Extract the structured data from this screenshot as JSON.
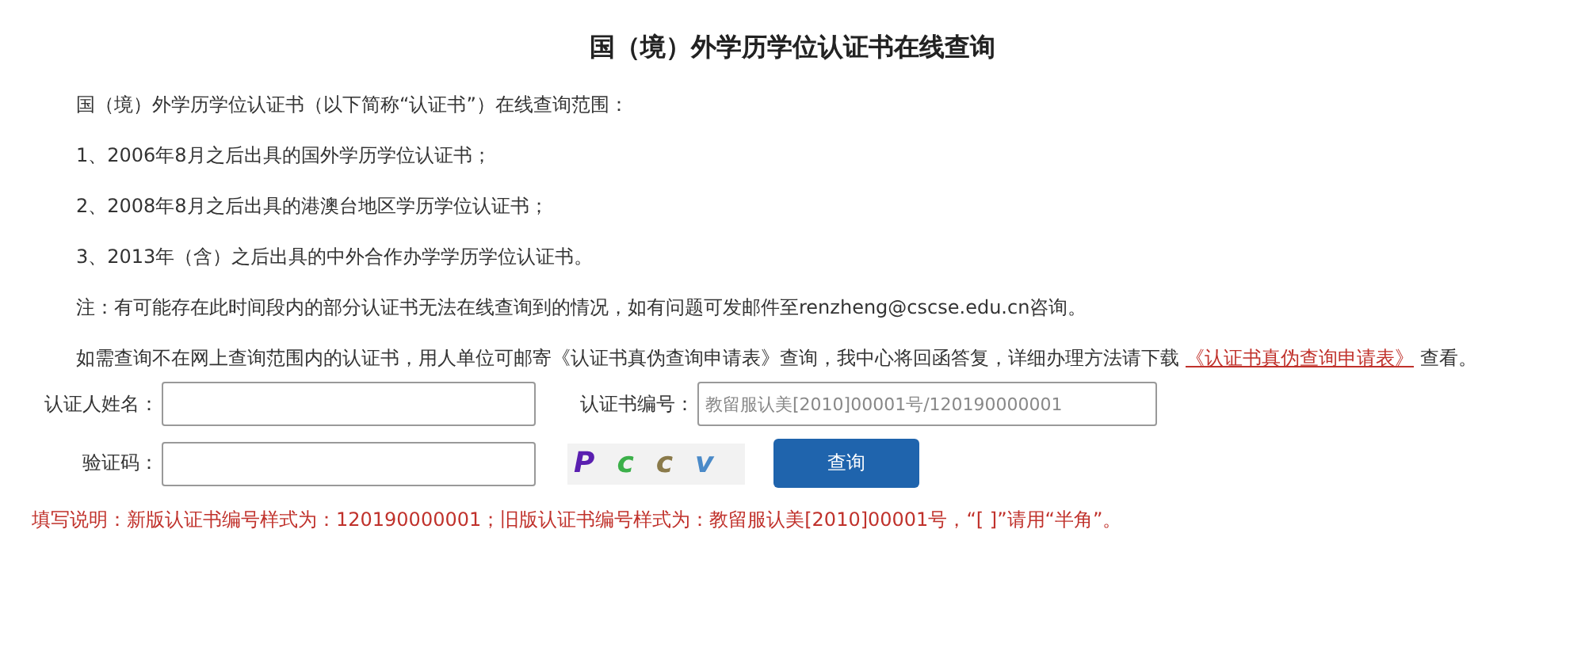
{
  "title": "国（境）外学历学位认证书在线查询",
  "paragraphs": [
    {
      "text": "国（境）外学历学位认证书（以下简称“认证书”）在线查询范围："
    },
    {
      "text": "1、2006年8月之后出具的国外学历学位认证书；"
    },
    {
      "text": "2、2008年8月之后出具的港澳台地区学历学位认证书；"
    },
    {
      "text": "3、2013年（含）之后出具的中外合作办学学历学位认证书。"
    },
    {
      "text": "注：有可能存在此时间段内的部分认证书无法在线查询到的情况，如有问题可发邮件至renzheng@cscse.edu.cn咨询。"
    }
  ],
  "download_note": {
    "before": "如需查询不在网上查询范围内的认证书，用人单位可邮寄《认证书真伪查询申请表》查询，我中心将回函答复，详细办理方法请下载",
    "link": "《认证书真伪查询申请表》",
    "after": "查看。"
  },
  "form": {
    "name_label": "认证人姓名：",
    "cert_label": "认证书编号：",
    "cert_placeholder": "教留服认美[2010]00001号/120190000001",
    "captcha_label": "验证码：",
    "captcha": [
      {
        "char": "P",
        "color": "#5a1fb0"
      },
      {
        "char": "c",
        "color": "#3cb04a"
      },
      {
        "char": "c",
        "color": "#8a7a4a"
      },
      {
        "char": "v",
        "color": "#4a8ac8"
      }
    ],
    "submit": "查询"
  },
  "instructions": "填写说明：新版认证书编号样式为：120190000001；旧版认证书编号样式为：教留服认美[2010]00001号，“[ ]”请用“半角”。"
}
